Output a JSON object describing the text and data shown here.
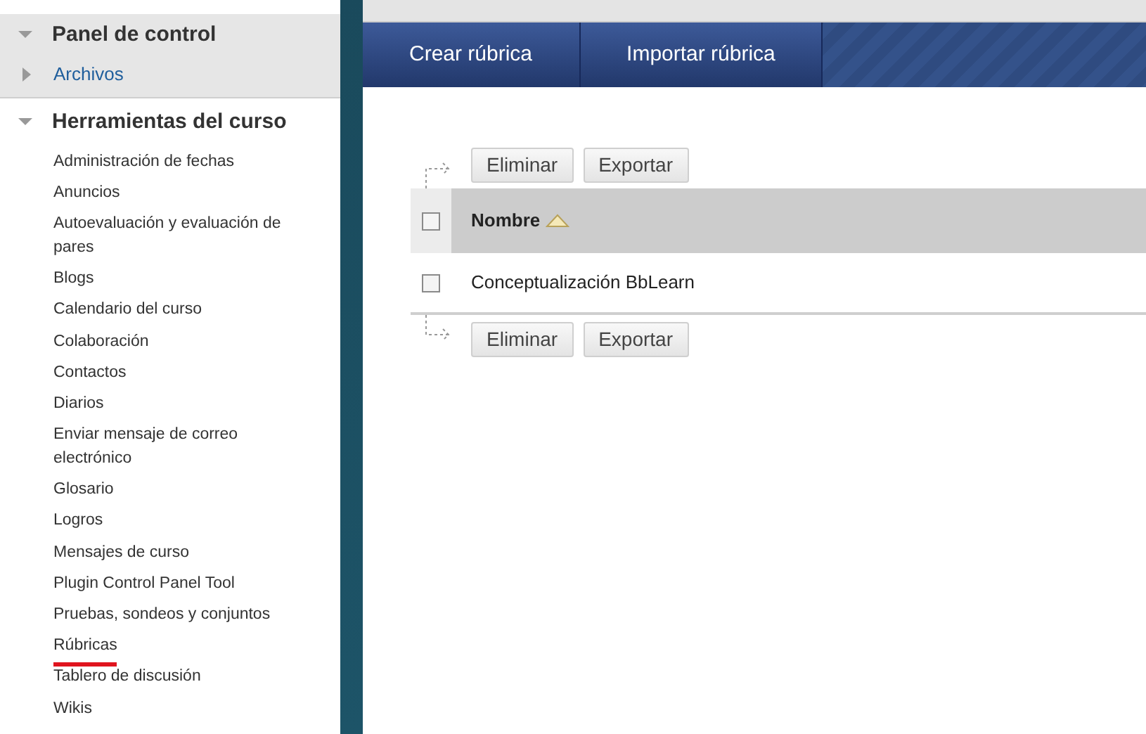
{
  "sidebar": {
    "sections": [
      {
        "label": "Panel de control",
        "expanded": true,
        "kind": "panel",
        "children": [
          {
            "label": "Archivos",
            "expanded": false
          }
        ]
      },
      {
        "label": "Herramientas del curso",
        "expanded": true,
        "kind": "list",
        "items": [
          {
            "label": "Administración de fechas",
            "underlined": false
          },
          {
            "label": "Anuncios",
            "underlined": false
          },
          {
            "label": "Autoevaluación y evaluación de pares",
            "underlined": false
          },
          {
            "label": "Blogs",
            "underlined": false
          },
          {
            "label": "Calendario del curso",
            "underlined": false
          },
          {
            "label": "Colaboración",
            "underlined": false
          },
          {
            "label": "Contactos",
            "underlined": false
          },
          {
            "label": "Diarios",
            "underlined": false
          },
          {
            "label": "Enviar mensaje de correo electrónico",
            "underlined": false
          },
          {
            "label": "Glosario",
            "underlined": false
          },
          {
            "label": "Logros",
            "underlined": false
          },
          {
            "label": "Mensajes de curso",
            "underlined": false
          },
          {
            "label": "Plugin Control Panel Tool",
            "underlined": false
          },
          {
            "label": "Pruebas, sondeos y conjuntos",
            "underlined": false
          },
          {
            "label": "Rúbricas",
            "underlined": true
          },
          {
            "label": "Tablero de discusión",
            "underlined": false
          },
          {
            "label": "Wikis",
            "underlined": false
          }
        ]
      }
    ]
  },
  "action_bar": [
    "Crear rúbrica",
    "Importar rúbrica"
  ],
  "top_buttons": [
    "Eliminar",
    "Exportar"
  ],
  "table": {
    "columns": [
      {
        "label": "Nombre",
        "sorted": true
      }
    ],
    "header_checked": false,
    "rows": [
      {
        "name": "Conceptualización BbLearn",
        "checked": false
      }
    ]
  },
  "bottom_buttons": [
    "Eliminar",
    "Exportar"
  ]
}
